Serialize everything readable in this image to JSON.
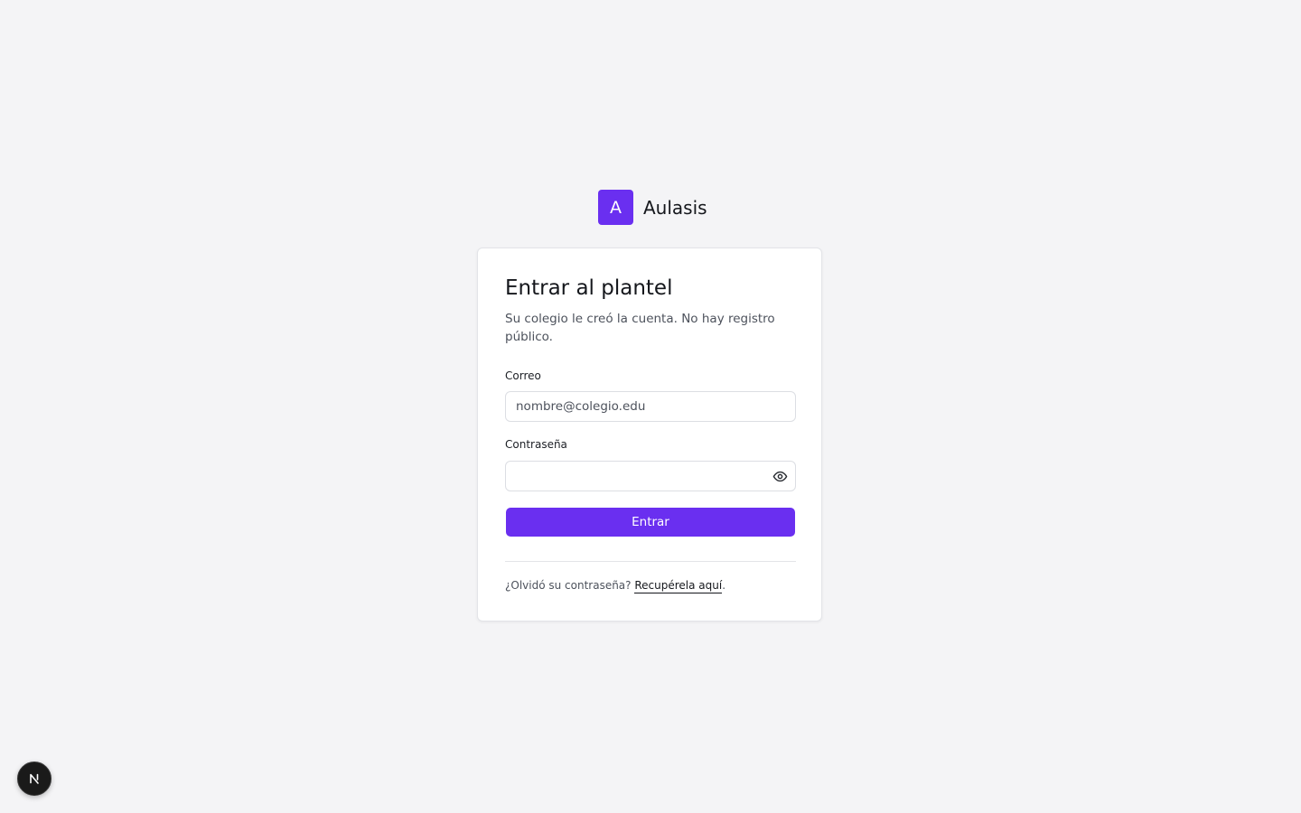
{
  "brand": {
    "logo_letter": "A",
    "name": "Aulasis",
    "accent_color": "#6a2ff0"
  },
  "login": {
    "title": "Entrar al plantel",
    "subtitle": "Su colegio le creó la cuenta. No hay registro público.",
    "email_label": "Correo",
    "email_placeholder": "nombre@colegio.edu",
    "password_label": "Contraseña",
    "password_toggle_icon": "eye-icon",
    "submit_label": "Entrar",
    "forgot_prefix": "¿Olvidó su contraseña? ",
    "forgot_link": "Recupérela aquí",
    "forgot_suffix": "."
  },
  "dev_badge": {
    "letter": "N"
  }
}
